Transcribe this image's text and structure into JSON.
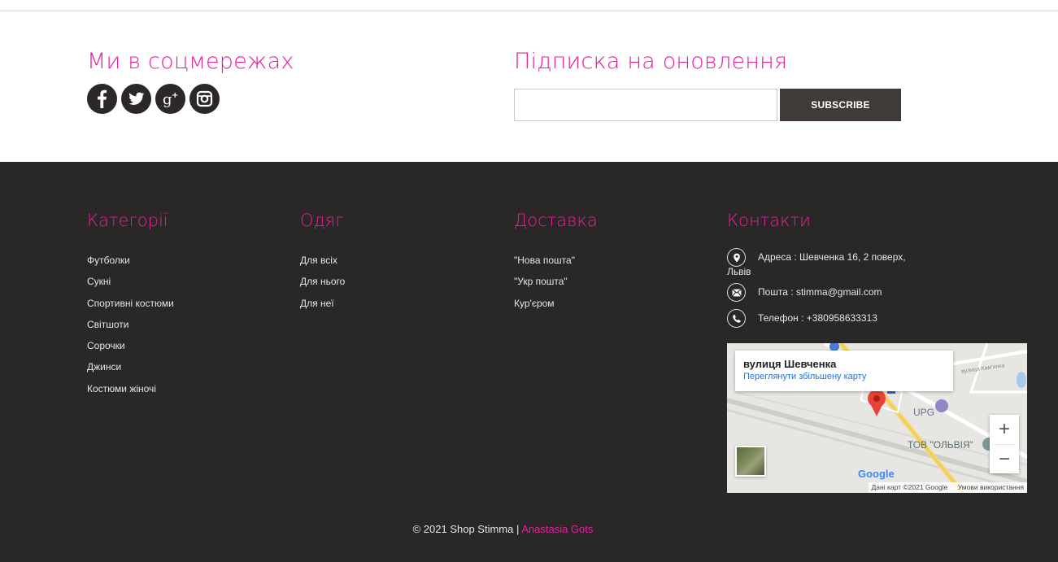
{
  "social": {
    "title": "Ми в соцмережах",
    "icons": [
      "facebook-icon",
      "twitter-icon",
      "google-plus-icon",
      "instagram-icon"
    ]
  },
  "subscribe": {
    "title": "Підписка на оновлення",
    "input_value": "",
    "button_label": "SUBSCRIBE"
  },
  "footer": {
    "categories": {
      "title": "Категорії",
      "items": [
        "Футболки",
        "Сукні",
        "Спортивні костюми",
        "Світшоти",
        "Сорочки",
        "Джинси",
        "Костюми жіночі"
      ]
    },
    "clothing": {
      "title": "Одяг",
      "items": [
        "Для всіх",
        "Для нього",
        "Для неї"
      ]
    },
    "delivery": {
      "title": "Доставка",
      "items": [
        "\"Нова пошта\"",
        "\"Укр пошта\"",
        "Кур'єром"
      ]
    },
    "contacts": {
      "title": "Контакти",
      "address": "Адреса : Шевченка 16, 2 поверх,",
      "address_cont": "Львів",
      "email": "Пошта : stimma@gmail.com",
      "phone": "Телефон : +380958633313"
    },
    "map": {
      "place_name": "вулиця Шевченка",
      "enlarge_link": "Переглянути збільшену карту",
      "label_upg": "UPG",
      "label_company": "ТОВ \"ОЛЬВІЯ\"",
      "label_street": "вулиця Кам'янка",
      "google_logo": "Google",
      "attribution": "Дані карт ©2021 Google",
      "terms": "Умови використання"
    },
    "copyright": "© 2021 Shop Stimma | ",
    "author": "Anastasia Gots"
  },
  "colors": {
    "accent": "#e91e9e",
    "footer_bg": "#2a2727",
    "button_bg": "#403b39",
    "social_bg": "#2b2827"
  }
}
